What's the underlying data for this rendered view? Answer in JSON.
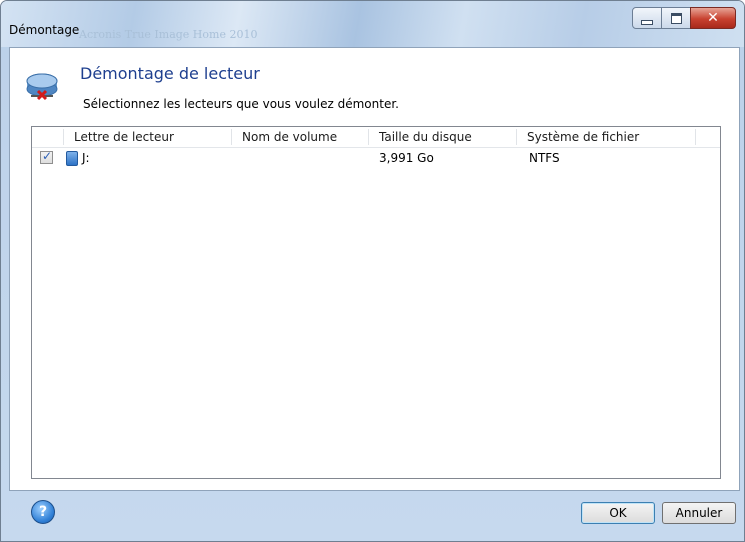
{
  "window": {
    "title": "Démontage",
    "ghost_title": "Acronis True Image Home 2010",
    "buttons": [
      "minimize",
      "maximize",
      "close"
    ]
  },
  "header": {
    "title": "Démontage de lecteur",
    "subtitle": "Sélectionnez les lecteurs que vous voulez démonter.",
    "icon": "unmount-drive-icon"
  },
  "table": {
    "columns": [
      "Lettre de lecteur",
      "Nom de volume",
      "Taille du disque",
      "Système de fichier"
    ],
    "rows": [
      {
        "checked": true,
        "letter": "J:",
        "volume": "",
        "size": "3,991 Go",
        "filesystem": "NTFS"
      }
    ]
  },
  "footer": {
    "help_label": "?",
    "ok_label": "OK",
    "cancel_label": "Annuler"
  },
  "colors": {
    "header_title": "#1e3f8f",
    "window_frame": "#b9d1ea",
    "close_button": "#c8412f"
  }
}
